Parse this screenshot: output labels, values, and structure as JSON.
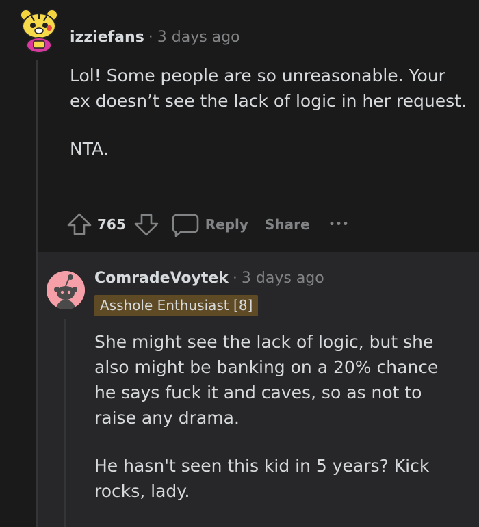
{
  "comment": {
    "username": "izziefans",
    "separator": "·",
    "time": "3 days ago",
    "paragraphs": [
      "Lol! Some people are so unreasonable. Your ex doesn’t see the lack of logic in her request.",
      "NTA."
    ],
    "score": "765",
    "reply_label": "Reply",
    "share_label": "Share",
    "more_label": "•••"
  },
  "reply": {
    "username": "ComradeVoytek",
    "separator": "·",
    "time": "3 days ago",
    "flair": "Asshole Enthusiast [8]",
    "paragraphs": [
      "She might see the lack of logic, but she also might be banking on a 20% chance he says fuck it and caves, so as not to raise any drama.",
      "He hasn't seen this kid in 5 years? Kick rocks, lady."
    ]
  },
  "colors": {
    "background": "#1a1a1b",
    "reply_background": "#272729",
    "text": "#d7dadc",
    "muted": "#818384",
    "flair_background": "#5e4a24",
    "avatar_pink": "#f5a0a8"
  },
  "icons": {
    "upvote": "upvote-arrow-icon",
    "downvote": "downvote-arrow-icon",
    "comment": "comment-bubble-icon",
    "more": "more-dots-icon",
    "avatar1": "snoo-tiger-avatar",
    "avatar2": "snoo-default-avatar"
  }
}
